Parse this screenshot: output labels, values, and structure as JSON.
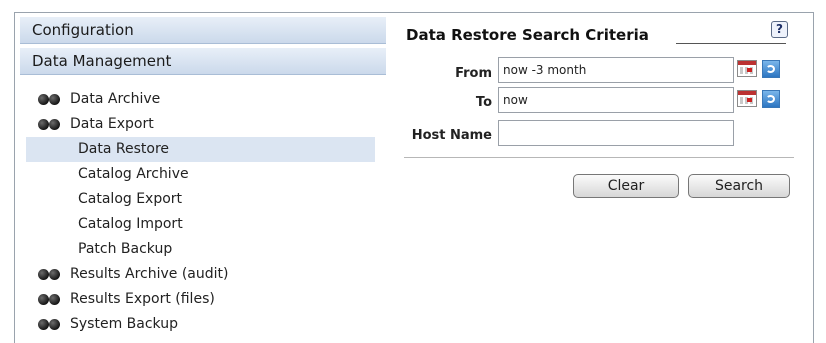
{
  "sidebar": {
    "configuration_label": "Configuration",
    "data_management_label": "Data Management",
    "items": [
      {
        "label": "Data Archive"
      },
      {
        "label": "Data Export"
      },
      {
        "label": "Data Restore"
      },
      {
        "label": "Catalog Archive"
      },
      {
        "label": "Catalog Export"
      },
      {
        "label": "Catalog Import"
      },
      {
        "label": "Patch Backup"
      },
      {
        "label": "Results Archive (audit)"
      },
      {
        "label": "Results Export (files)"
      },
      {
        "label": "System Backup"
      }
    ]
  },
  "panel": {
    "title": "Data Restore Search Criteria",
    "help_glyph": "?",
    "from_label": "From",
    "from_value": "now -3 month",
    "to_label": "To",
    "to_value": "now",
    "host_label": "Host Name",
    "host_value": "",
    "clear_label": "Clear",
    "search_label": "Search"
  },
  "icons": {
    "tree_node": "double-dot-icon",
    "calendar": "calendar-icon",
    "go": "refresh-go-icon",
    "help": "help-icon"
  }
}
